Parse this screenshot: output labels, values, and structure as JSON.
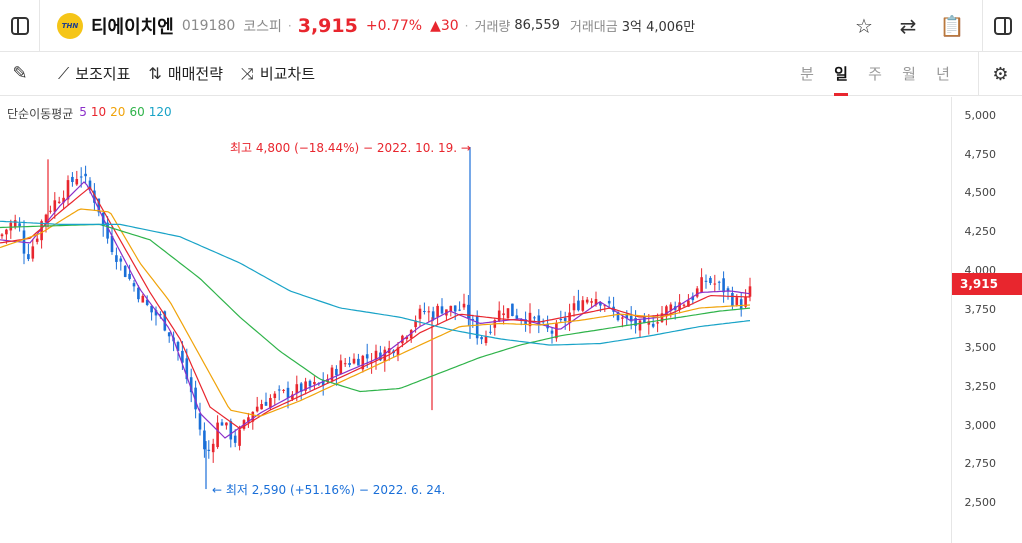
{
  "header": {
    "logo_text": "THN",
    "name": "티에이치엔",
    "code": "019180",
    "market": "코스피",
    "price": "3,915",
    "change_pct": "+0.77%",
    "change_abs": "▲30",
    "volume_label": "거래량",
    "volume": "86,559",
    "amount_label": "거래대금",
    "amount": "3억 4,006만"
  },
  "toolbar": {
    "indicators": "보조지표",
    "strategy": "매매전략",
    "compare": "비교차트",
    "periods": [
      "분",
      "일",
      "주",
      "월",
      "년"
    ],
    "active_period": "일"
  },
  "colors": {
    "up": "#e8262e",
    "down": "#1a6fd8",
    "ma5": "#8b2fc9",
    "ma10": "#e8262e",
    "ma20": "#f0a30a",
    "ma60": "#2fb34a",
    "ma120": "#19a3c7"
  },
  "legend": {
    "title": "단순이동평균",
    "periods": [
      "5",
      "10",
      "20",
      "60",
      "120"
    ]
  },
  "chart_data": {
    "type": "candlestick",
    "y_ticks": [
      "5,000",
      "4,750",
      "4,500",
      "4,250",
      "4,000",
      "3,750",
      "3,500",
      "3,250",
      "3,000",
      "2,750",
      "2,500"
    ],
    "ylim": [
      2450,
      5050
    ],
    "current_price": "3,915",
    "high_annotation": "최고 4,800 (−18.44%) − 2022. 10. 19.",
    "low_annotation": "최저 2,590 (+51.16%) − 2022. 6. 24.",
    "close_path": [
      [
        0,
        4220
      ],
      [
        10,
        4300
      ],
      [
        18,
        4320
      ],
      [
        26,
        4080
      ],
      [
        34,
        4180
      ],
      [
        44,
        4360
      ],
      [
        54,
        4440
      ],
      [
        62,
        4500
      ],
      [
        70,
        4560
      ],
      [
        80,
        4640
      ],
      [
        90,
        4520
      ],
      [
        98,
        4420
      ],
      [
        104,
        4260
      ],
      [
        110,
        4180
      ],
      [
        118,
        4080
      ],
      [
        126,
        3980
      ],
      [
        134,
        3900
      ],
      [
        142,
        3820
      ],
      [
        150,
        3740
      ],
      [
        160,
        3700
      ],
      [
        168,
        3620
      ],
      [
        176,
        3520
      ],
      [
        184,
        3360
      ],
      [
        192,
        3200
      ],
      [
        200,
        2980
      ],
      [
        206,
        2780
      ],
      [
        212,
        2900
      ],
      [
        220,
        3050
      ],
      [
        228,
        2960
      ],
      [
        236,
        2900
      ],
      [
        244,
        3000
      ],
      [
        252,
        3100
      ],
      [
        262,
        3150
      ],
      [
        272,
        3180
      ],
      [
        282,
        3200
      ],
      [
        292,
        3220
      ],
      [
        302,
        3240
      ],
      [
        312,
        3250
      ],
      [
        322,
        3260
      ],
      [
        332,
        3340
      ],
      [
        342,
        3400
      ],
      [
        352,
        3420
      ],
      [
        362,
        3440
      ],
      [
        372,
        3440
      ],
      [
        382,
        3470
      ],
      [
        392,
        3500
      ],
      [
        400,
        3560
      ],
      [
        408,
        3620
      ],
      [
        416,
        3700
      ],
      [
        424,
        3740
      ],
      [
        432,
        3720
      ],
      [
        440,
        3760
      ],
      [
        448,
        3760
      ],
      [
        456,
        3740
      ],
      [
        462,
        3760
      ],
      [
        470,
        3700
      ],
      [
        476,
        3600
      ],
      [
        484,
        3560
      ],
      [
        494,
        3700
      ],
      [
        504,
        3760
      ],
      [
        514,
        3720
      ],
      [
        524,
        3700
      ],
      [
        534,
        3680
      ],
      [
        544,
        3620
      ],
      [
        554,
        3600
      ],
      [
        564,
        3680
      ],
      [
        574,
        3760
      ],
      [
        584,
        3820
      ],
      [
        594,
        3840
      ],
      [
        604,
        3800
      ],
      [
        614,
        3720
      ],
      [
        624,
        3680
      ],
      [
        634,
        3660
      ],
      [
        644,
        3620
      ],
      [
        654,
        3680
      ],
      [
        664,
        3740
      ],
      [
        674,
        3780
      ],
      [
        684,
        3800
      ],
      [
        694,
        3840
      ],
      [
        704,
        3940
      ],
      [
        714,
        3920
      ],
      [
        724,
        3880
      ],
      [
        732,
        3820
      ],
      [
        740,
        3780
      ],
      [
        748,
        3820
      ],
      [
        752,
        3915
      ]
    ],
    "ma_paths": {
      "ma5": [
        [
          0,
          4200
        ],
        [
          30,
          4180
        ],
        [
          60,
          4420
        ],
        [
          85,
          4580
        ],
        [
          110,
          4250
        ],
        [
          140,
          3880
        ],
        [
          170,
          3620
        ],
        [
          200,
          3080
        ],
        [
          225,
          2920
        ],
        [
          260,
          3080
        ],
        [
          300,
          3220
        ],
        [
          340,
          3330
        ],
        [
          380,
          3440
        ],
        [
          420,
          3640
        ],
        [
          450,
          3740
        ],
        [
          480,
          3660
        ],
        [
          520,
          3690
        ],
        [
          560,
          3620
        ],
        [
          600,
          3800
        ],
        [
          630,
          3680
        ],
        [
          660,
          3700
        ],
        [
          700,
          3860
        ],
        [
          730,
          3870
        ],
        [
          752,
          3850
        ]
      ],
      "ma10": [
        [
          0,
          4180
        ],
        [
          30,
          4210
        ],
        [
          60,
          4380
        ],
        [
          90,
          4540
        ],
        [
          120,
          4200
        ],
        [
          150,
          3860
        ],
        [
          180,
          3560
        ],
        [
          210,
          3120
        ],
        [
          240,
          2980
        ],
        [
          270,
          3100
        ],
        [
          310,
          3220
        ],
        [
          350,
          3340
        ],
        [
          390,
          3460
        ],
        [
          420,
          3600
        ],
        [
          460,
          3720
        ],
        [
          500,
          3690
        ],
        [
          540,
          3670
        ],
        [
          580,
          3720
        ],
        [
          610,
          3760
        ],
        [
          640,
          3700
        ],
        [
          670,
          3720
        ],
        [
          710,
          3840
        ],
        [
          752,
          3830
        ]
      ],
      "ma20": [
        [
          0,
          4150
        ],
        [
          40,
          4240
        ],
        [
          80,
          4400
        ],
        [
          110,
          4380
        ],
        [
          140,
          4050
        ],
        [
          170,
          3800
        ],
        [
          200,
          3450
        ],
        [
          230,
          3100
        ],
        [
          260,
          3060
        ],
        [
          300,
          3160
        ],
        [
          340,
          3280
        ],
        [
          380,
          3400
        ],
        [
          420,
          3520
        ],
        [
          460,
          3640
        ],
        [
          500,
          3660
        ],
        [
          540,
          3650
        ],
        [
          580,
          3680
        ],
        [
          620,
          3720
        ],
        [
          660,
          3700
        ],
        [
          700,
          3760
        ],
        [
          752,
          3780
        ]
      ],
      "ma60": [
        [
          0,
          4280
        ],
        [
          50,
          4290
        ],
        [
          100,
          4300
        ],
        [
          150,
          4200
        ],
        [
          200,
          3950
        ],
        [
          240,
          3700
        ],
        [
          280,
          3480
        ],
        [
          320,
          3300
        ],
        [
          360,
          3220
        ],
        [
          400,
          3240
        ],
        [
          440,
          3340
        ],
        [
          480,
          3440
        ],
        [
          520,
          3520
        ],
        [
          560,
          3580
        ],
        [
          600,
          3620
        ],
        [
          640,
          3660
        ],
        [
          680,
          3700
        ],
        [
          720,
          3740
        ],
        [
          752,
          3760
        ]
      ],
      "ma120": [
        [
          0,
          4320
        ],
        [
          60,
          4300
        ],
        [
          120,
          4300
        ],
        [
          180,
          4220
        ],
        [
          240,
          4050
        ],
        [
          290,
          3870
        ],
        [
          340,
          3760
        ],
        [
          400,
          3700
        ],
        [
          450,
          3620
        ],
        [
          500,
          3560
        ],
        [
          550,
          3520
        ],
        [
          600,
          3530
        ],
        [
          650,
          3580
        ],
        [
          700,
          3640
        ],
        [
          752,
          3680
        ]
      ]
    }
  }
}
